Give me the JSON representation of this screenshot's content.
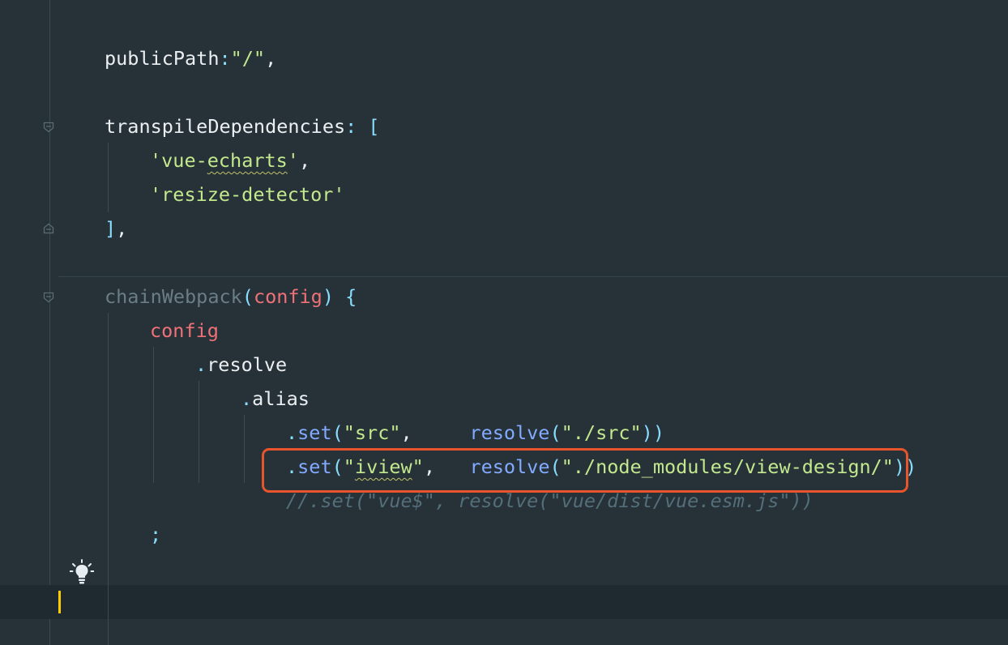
{
  "code": {
    "line_public_path": {
      "key": "publicPath",
      "colon": ":",
      "value": "\"/\"",
      "comma": ","
    },
    "line_transpile": {
      "key": "transpileDependencies",
      "colon": ":",
      "bracket": " ["
    },
    "line_vue_echarts": {
      "open": "'vue-",
      "squiggled": "echarts",
      "close": "'",
      "comma": ","
    },
    "line_resize_detector": {
      "value": "'resize-detector'"
    },
    "line_close_bracket": {
      "bracket": "]",
      "comma": ","
    },
    "line_chain_webpack": {
      "name": "chainWebpack",
      "open_paren": "(",
      "param": "config",
      "close": ") {"
    },
    "line_config": {
      "text": "config"
    },
    "line_resolve": {
      "dot": ".",
      "text": "resolve"
    },
    "line_alias": {
      "dot": ".",
      "text": "alias"
    },
    "line_set_src": {
      "dot": ".",
      "method": "set",
      "paren1": "(",
      "key": "\"src\"",
      "comma": ",",
      "spacing": "     ",
      "resolve": "resolve",
      "paren2": "(",
      "path": "\"./src\"",
      "close": "))"
    },
    "line_set_iview": {
      "dot": ".",
      "method": "set",
      "paren1": "(",
      "key_open": "\"",
      "key_squiggled": "iview",
      "key_close": "\"",
      "comma": ",",
      "spacing": "   ",
      "resolve": "resolve",
      "paren2": "(",
      "path": "\"./node_modules/view-design/\"",
      "close": "))"
    },
    "line_comment": {
      "text": "//.set(\"vue$\", resolve(\"vue/dist/vue.esm.js\"))"
    },
    "line_semicolon": {
      "text": ";"
    }
  },
  "colors": {
    "background": "#263238",
    "current_line": "#1f2a30",
    "highlight_box": "#e8542c",
    "caret": "#ffcc00",
    "string": "#c3e88d",
    "function": "#82aaff",
    "punctuation": "#89ddff",
    "parameter": "#f07178",
    "comment": "#546e7a"
  },
  "icons": {
    "fold_markers": [
      "fold-open-icon",
      "fold-close-icon",
      "fold-open-icon"
    ],
    "intention": "lightbulb-icon"
  }
}
